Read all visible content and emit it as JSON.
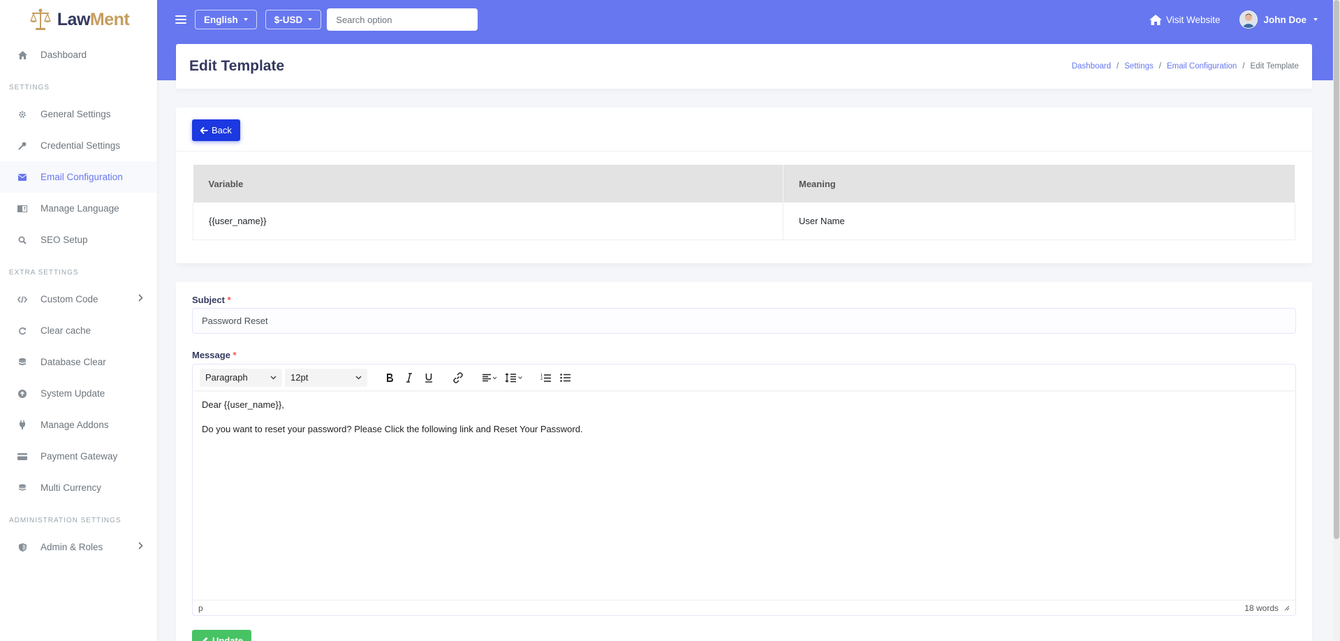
{
  "brand": {
    "name_part1": "Law",
    "name_part2": "Ment"
  },
  "sidebar": {
    "dashboard": "Dashboard",
    "section_settings": "Settings",
    "settings_items": [
      {
        "label": "General Settings",
        "icon": "gear-icon"
      },
      {
        "label": "Credential Settings",
        "icon": "key-icon"
      },
      {
        "label": "Email Configuration",
        "icon": "envelope-icon",
        "active": true
      },
      {
        "label": "Manage Language",
        "icon": "language-icon"
      },
      {
        "label": "SEO Setup",
        "icon": "search-icon"
      }
    ],
    "section_extra": "Extra Settings",
    "extra_items": [
      {
        "label": "Custom Code",
        "icon": "code-icon"
      },
      {
        "label": "Clear cache",
        "icon": "refresh-icon"
      },
      {
        "label": "Database Clear",
        "icon": "database-icon"
      },
      {
        "label": "System Update",
        "icon": "upload-icon"
      },
      {
        "label": "Manage Addons",
        "icon": "plug-icon"
      },
      {
        "label": "Payment Gateway",
        "icon": "credit-card-icon"
      },
      {
        "label": "Multi Currency",
        "icon": "coins-icon"
      }
    ],
    "section_admin": "Administration Settings",
    "admin_items": [
      {
        "label": "Admin & Roles",
        "icon": "shield-icon"
      }
    ]
  },
  "topbar": {
    "language": "English",
    "currency": "$-USD",
    "search_placeholder": "Search option",
    "visit_website": "Visit Website",
    "user_name": "John Doe"
  },
  "header": {
    "title": "Edit Template",
    "breadcrumb": [
      "Dashboard",
      "Settings",
      "Email Configuration",
      "Edit Template"
    ]
  },
  "variables": {
    "back_label": "Back",
    "columns": [
      "Variable",
      "Meaning"
    ],
    "rows": [
      [
        "{{user_name}}",
        "User Name"
      ]
    ]
  },
  "form": {
    "subject_label": "Subject",
    "subject_value": "Password Reset",
    "message_label": "Message",
    "toolbar": {
      "block_format": "Paragraph",
      "font_size": "12pt"
    },
    "message_lines": [
      "Dear {{user_name}},",
      "Do you want to reset your password? Please Click the following link and Reset Your Password."
    ],
    "status_path": "p",
    "word_count": "18 words",
    "update_label": "Update"
  },
  "colors": {
    "accent": "#6777ef",
    "back_button": "#1c38e0",
    "update_button": "#47c363",
    "brand_gold": "#c59d5f"
  }
}
